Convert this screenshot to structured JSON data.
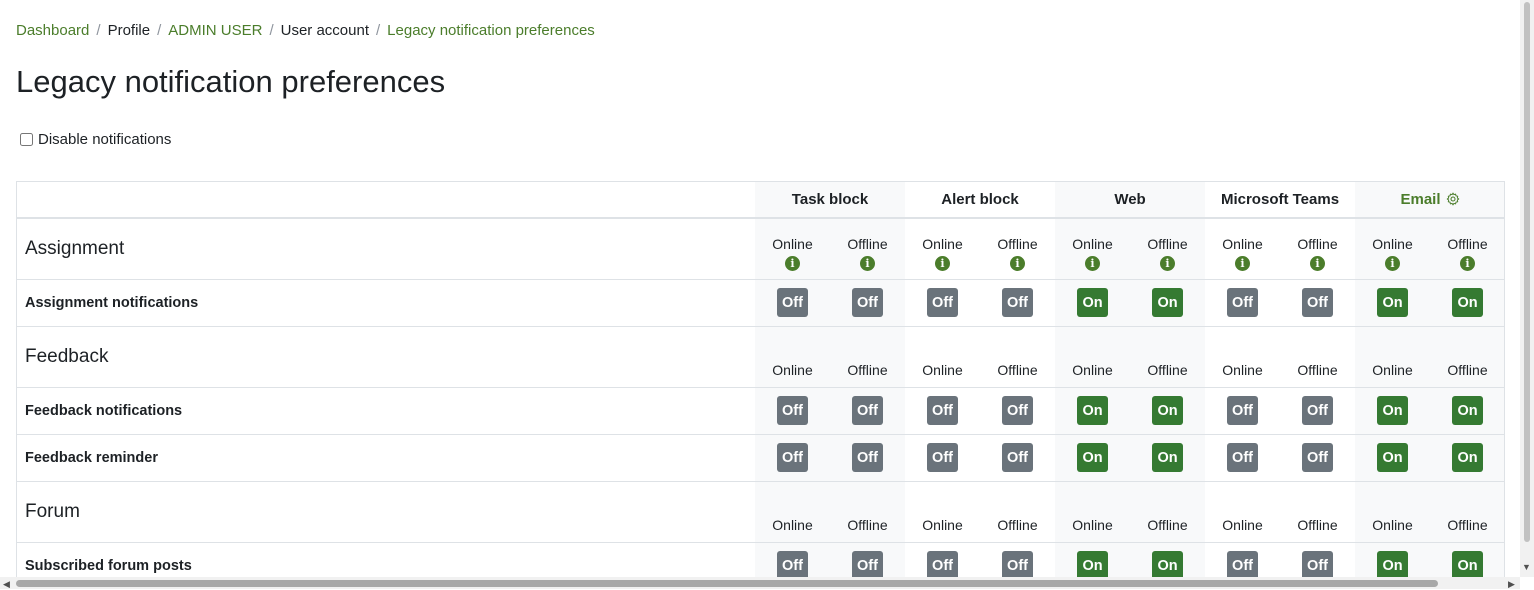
{
  "breadcrumb": [
    {
      "label": "Dashboard",
      "link": true
    },
    {
      "label": "Profile",
      "link": false
    },
    {
      "label": "ADMIN USER",
      "link": true
    },
    {
      "label": "User account",
      "link": false
    },
    {
      "label": "Legacy notification preferences",
      "link": true
    }
  ],
  "page": {
    "title": "Legacy notification preferences",
    "disable_label": "Disable notifications",
    "disable_checked": false
  },
  "processors": [
    {
      "label": "Task block",
      "shade": true
    },
    {
      "label": "Alert block",
      "shade": false
    },
    {
      "label": "Web",
      "shade": true
    },
    {
      "label": "Microsoft Teams",
      "shade": false
    },
    {
      "label": "Email",
      "shade": true,
      "has_settings": true
    }
  ],
  "states": {
    "online": "Online",
    "offline": "Offline",
    "info_glyph": "i"
  },
  "toggle": {
    "on": "On",
    "off": "Off"
  },
  "colors": {
    "accent": "#4b7d2b",
    "toggle_on": "#357a32",
    "toggle_off": "#6a737b"
  },
  "sections": [
    {
      "name": "Assignment",
      "show_info": true,
      "rows": [
        {
          "name": "Assignment notifications",
          "values": [
            false,
            false,
            false,
            false,
            true,
            true,
            false,
            false,
            true,
            true
          ]
        }
      ]
    },
    {
      "name": "Feedback",
      "show_info": false,
      "rows": [
        {
          "name": "Feedback notifications",
          "values": [
            false,
            false,
            false,
            false,
            true,
            true,
            false,
            false,
            true,
            true
          ]
        },
        {
          "name": "Feedback reminder",
          "values": [
            false,
            false,
            false,
            false,
            true,
            true,
            false,
            false,
            true,
            true
          ]
        }
      ]
    },
    {
      "name": "Forum",
      "show_info": false,
      "rows": [
        {
          "name": "Subscribed forum posts",
          "values": [
            false,
            false,
            false,
            false,
            true,
            true,
            false,
            false,
            true,
            true
          ]
        }
      ]
    }
  ]
}
